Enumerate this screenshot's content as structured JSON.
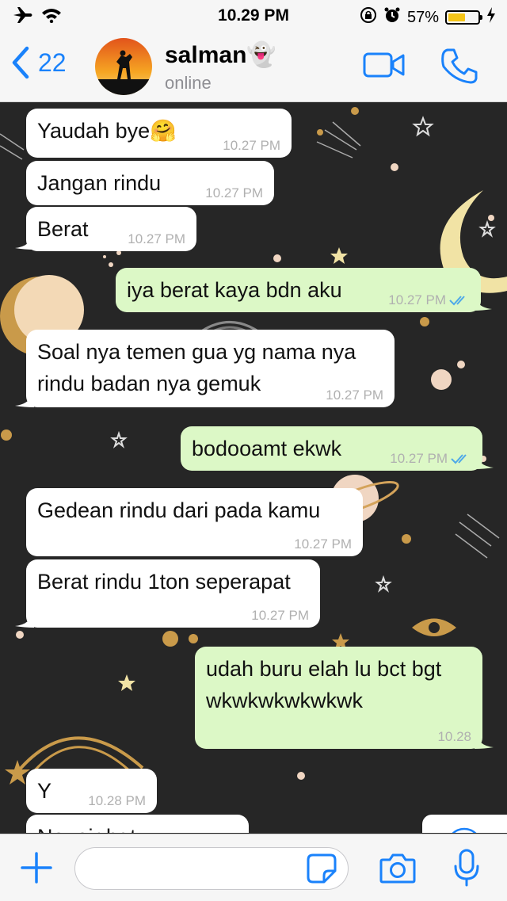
{
  "status_bar": {
    "time": "10.29 PM",
    "battery_percent": "57%",
    "battery_level": 0.57,
    "icons": [
      "airplane-icon",
      "wifi-icon",
      "orientation-lock-icon",
      "alarm-icon",
      "charging-icon"
    ]
  },
  "header": {
    "back_count": "22",
    "contact_name": "salman👻",
    "contact_status": "online",
    "icons": [
      "back-chevron-icon",
      "video-call-icon",
      "voice-call-icon"
    ]
  },
  "messages": [
    {
      "dir": "in",
      "text": "Yaudah bye🤗",
      "time": "10.27 PM"
    },
    {
      "dir": "in",
      "text": "Jangan rindu",
      "time": "10.27 PM"
    },
    {
      "dir": "in",
      "text": "Berat",
      "time": "10.27 PM"
    },
    {
      "dir": "out",
      "text": "iya berat kaya bdn aku",
      "time": "10.27 PM"
    },
    {
      "dir": "in",
      "text": "Soal nya temen gua yg nama nya rindu badan nya gemuk",
      "time": "10.27 PM"
    },
    {
      "dir": "out",
      "text": "bodooamt ekwk",
      "time": "10.27 PM"
    },
    {
      "dir": "in",
      "text": "Gedean rindu dari pada kamu",
      "time": "10.27 PM"
    },
    {
      "dir": "in",
      "text": "Berat rindu 1ton seperapat",
      "time": "10.27 PM"
    },
    {
      "dir": "out",
      "text": "udah buru elah lu bct bgt wkwkwkwkwkwk",
      "time": "10.28"
    },
    {
      "dir": "in",
      "text": "Y",
      "time": "10.28 PM"
    },
    {
      "dir": "in",
      "text": "Naueir bgt",
      "time": ""
    }
  ],
  "input_bar": {
    "placeholder": "",
    "icons": [
      "plus-icon",
      "sticker-icon",
      "camera-icon",
      "microphone-icon"
    ]
  },
  "colors": {
    "accent": "#1a82fb",
    "outgoing_bubble": "#dcf8c6",
    "incoming_bubble": "#ffffff",
    "read_ticks": "#4fa9e8",
    "battery": "#f5c518"
  }
}
